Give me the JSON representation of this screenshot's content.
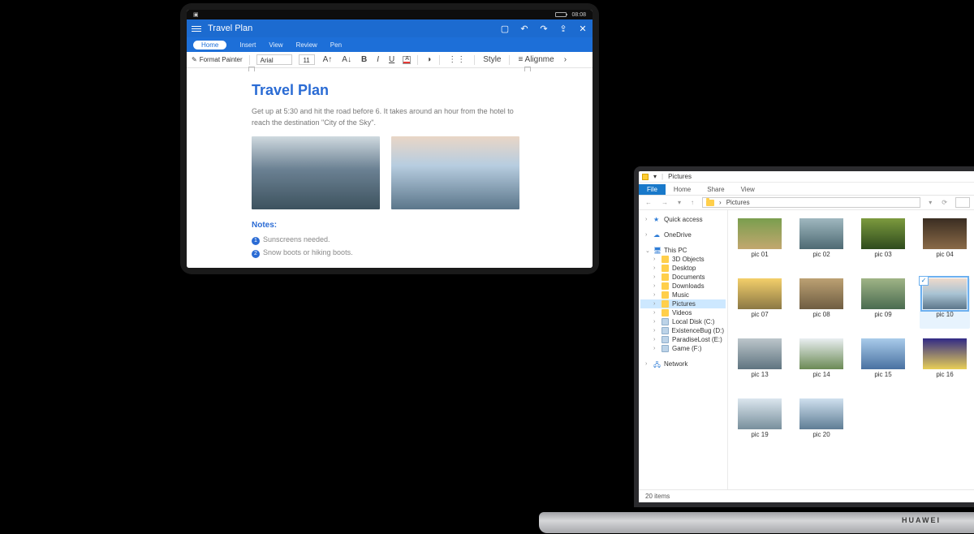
{
  "tablet": {
    "status": {
      "time": "08:08"
    },
    "titlebar": {
      "title": "Travel Plan"
    },
    "tabs": {
      "home": "Home",
      "insert": "Insert",
      "view": "View",
      "review": "Review",
      "pen": "Pen"
    },
    "toolbar": {
      "format_painter": "Format Painter",
      "font_name": "Arial",
      "font_size": "11",
      "style": "Style",
      "alignment": "Alignme"
    },
    "doc": {
      "h1": "Travel Plan",
      "body": "Get up at 5:30 and hit the road before 6. It takes around an hour from the hotel to reach the destination \"City of the Sky\".",
      "notes_h": "Notes:",
      "note1_num": "1",
      "note1": "Sunscreens needed.",
      "note2_num": "2",
      "note2": "Snow boots or hiking boots."
    }
  },
  "laptop": {
    "brand": "HUAWEI",
    "explorer": {
      "title_text": "Pictures",
      "ribbon": {
        "file": "File",
        "home": "Home",
        "share": "Share",
        "view": "View"
      },
      "breadcrumb": "Pictures",
      "tree": {
        "quick": "Quick access",
        "onedrive": "OneDrive",
        "thispc": "This PC",
        "objects3d": "3D Objects",
        "desktop": "Desktop",
        "documents": "Documents",
        "downloads": "Downloads",
        "music": "Music",
        "pictures": "Pictures",
        "videos": "Videos",
        "cdrive": "Local Disk (C:)",
        "ddrive": "ExistenceBug (D:)",
        "edrive": "ParadiseLost (E:)",
        "fdrive": "Game (F:)",
        "network": "Network"
      },
      "thumbs": {
        "p1": "pic 01",
        "p2": "pic 02",
        "p3": "pic 03",
        "p4": "pic 04",
        "p5": "pic 07",
        "p6": "pic 08",
        "p7": "pic 09",
        "p8": "pic 10",
        "p9": "pic 13",
        "p10": "pic 14",
        "p11": "pic 15",
        "p12": "pic 16",
        "p13": "pic 19",
        "p14": "pic 20"
      },
      "status": "20 items"
    }
  }
}
